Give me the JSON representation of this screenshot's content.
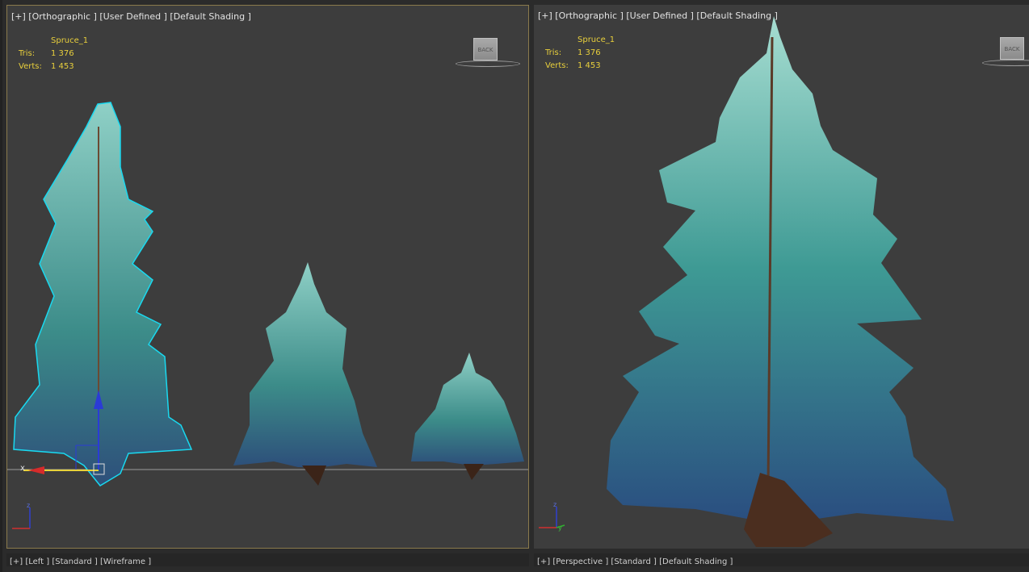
{
  "viewports": [
    {
      "id": "left",
      "label": "[+] [Orthographic ] [User Defined ] [Default Shading ]",
      "object_name": "Spruce_1",
      "stats": [
        {
          "key": "Tris:",
          "value": "1 376"
        },
        {
          "key": "Verts:",
          "value": "1 453"
        }
      ],
      "viewcube_text": "BACK",
      "axis_x": "x",
      "axis_z": "z",
      "active": true
    },
    {
      "id": "right",
      "label": "[+] [Orthographic ] [User Defined ] [Default Shading ]",
      "object_name": "Spruce_1",
      "stats": [
        {
          "key": "Tris:",
          "value": "1 376"
        },
        {
          "key": "Verts:",
          "value": "1 453"
        }
      ],
      "viewcube_text": "BACK",
      "axis_z": "z",
      "axis_y": "y",
      "active": false
    }
  ],
  "bottom_viewports": [
    {
      "label": "[+] [Left ] [Standard ] [Wireframe ]"
    },
    {
      "label": "[+] [Perspective ] [Standard ] [Default Shading ]"
    }
  ],
  "colors": {
    "viewport_bg": "#3d3d3d",
    "stats_text": "#e8cf3c",
    "selection_outline": "#19d9f0",
    "active_border": "#8a7a4c",
    "foliage": "#4fa39c",
    "trunk": "#4b2e1f"
  }
}
